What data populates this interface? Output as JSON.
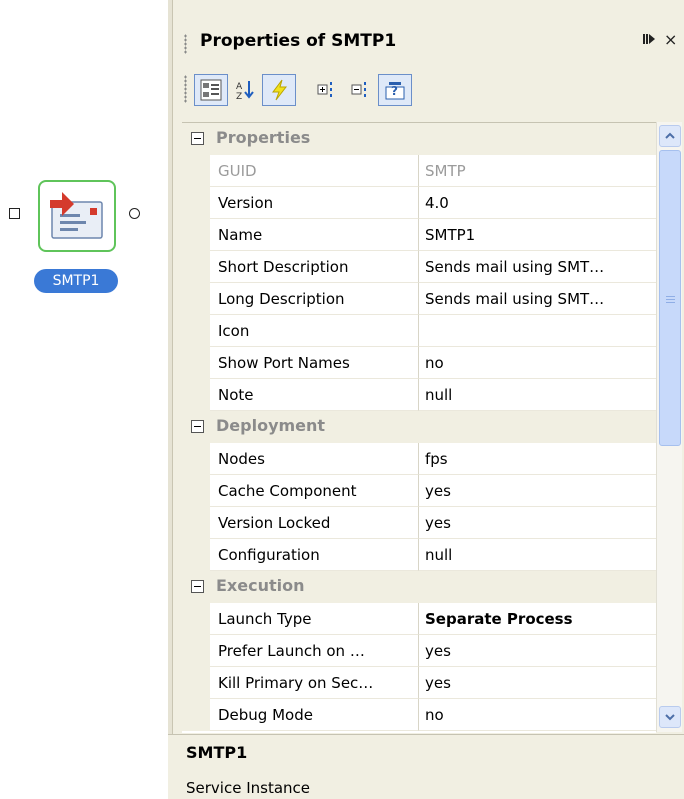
{
  "component": {
    "label": "SMTP1",
    "icon": "email-service-icon",
    "in_port_icon": "square-port-icon",
    "out_port_icon": "circle-port-icon"
  },
  "panel": {
    "title": "Properties of SMTP1",
    "buttons": {
      "menu_icon": "dock-arrow-icon",
      "close_label": "×"
    },
    "toolbar": [
      {
        "icon": "categorized-view-icon",
        "active": true
      },
      {
        "icon": "sort-alphabetical-icon",
        "active": false
      },
      {
        "icon": "lightning-icon",
        "active": true
      },
      {
        "icon": "expand-all-icon",
        "active": false
      },
      {
        "icon": "collapse-all-icon",
        "active": false
      },
      {
        "icon": "help-description-icon",
        "active": true
      }
    ]
  },
  "categories": [
    {
      "label": "Properties",
      "rows": [
        {
          "name": "GUID",
          "value": "SMTP",
          "readonly": true
        },
        {
          "name": "Version",
          "value": "4.0"
        },
        {
          "name": "Name",
          "value": "SMTP1"
        },
        {
          "name": "Short Description",
          "value": "Sends mail using SMT…"
        },
        {
          "name": "Long Description",
          "value": "Sends mail using SMT…"
        },
        {
          "name": "Icon",
          "value": ""
        },
        {
          "name": "Show Port Names",
          "value": "no"
        },
        {
          "name": "Note",
          "value": "null"
        }
      ]
    },
    {
      "label": "Deployment",
      "rows": [
        {
          "name": "Nodes",
          "value": "fps"
        },
        {
          "name": "Cache Component",
          "value": "yes"
        },
        {
          "name": "Version Locked",
          "value": "yes"
        },
        {
          "name": "Configuration",
          "value": "null"
        }
      ]
    },
    {
      "label": "Execution",
      "rows": [
        {
          "name": "Launch Type",
          "value": "Separate Process",
          "bold": true
        },
        {
          "name": "Prefer Launch on …",
          "value": "yes"
        },
        {
          "name": "Kill Primary on Sec…",
          "value": "yes"
        },
        {
          "name": "Debug Mode",
          "value": "no"
        }
      ]
    }
  ],
  "description": {
    "title": "SMTP1",
    "text": "Service Instance"
  },
  "colors": {
    "panel_bg": "#f1efe2",
    "selection_blue": "#3a79d6",
    "component_border": "#5fc45a",
    "scrollbar_thumb": "#c7d9fa"
  }
}
